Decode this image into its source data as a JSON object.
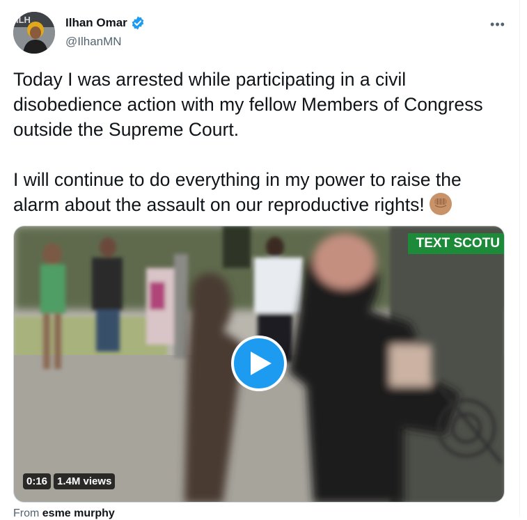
{
  "author": {
    "name": "Ilhan Omar",
    "handle": "@IlhanMN",
    "verified": true
  },
  "menu": {
    "more_label": "•••"
  },
  "tweet": {
    "paragraphs": [
      "Today I was arrested while participating in a civil disobedience action with my fellow Members of Congress outside the Supreme Court.",
      "I will continue to do everything in my power to raise the alarm about the assault on our reproductive rights!"
    ],
    "emoji": "raised-fist-medium-skin-tone-icon"
  },
  "video": {
    "banner_text": "TEXT SCOTU",
    "duration": "0:16",
    "views": "1.4M views"
  },
  "attribution": {
    "prefix": "From",
    "source": "esme murphy"
  },
  "colors": {
    "accent": "#1d9bf0",
    "text_primary": "#0f1419",
    "text_secondary": "#536471",
    "banner_green": "#1d8a3a"
  }
}
